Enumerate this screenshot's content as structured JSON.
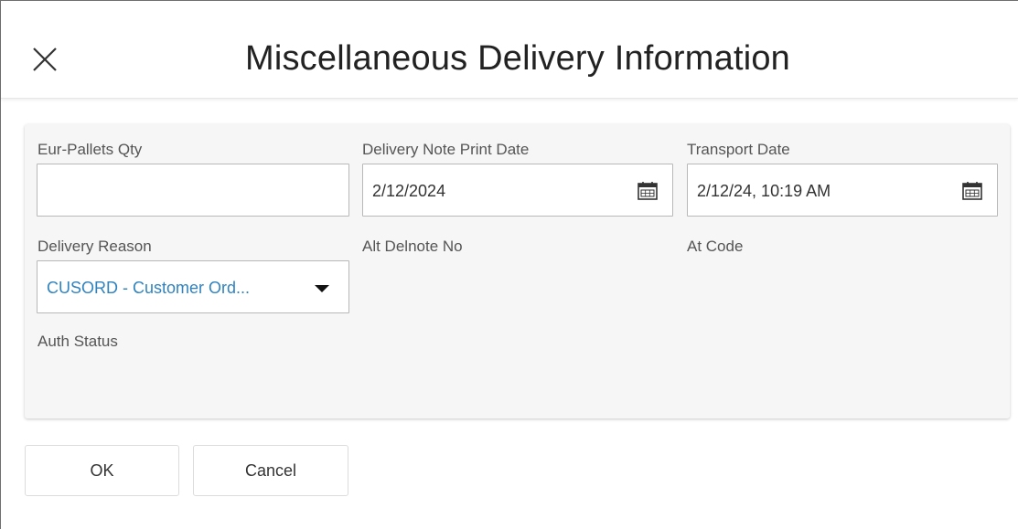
{
  "dialog": {
    "title": "Miscellaneous Delivery Information"
  },
  "fields": {
    "eur_pallets_qty": {
      "label": "Eur-Pallets Qty",
      "value": ""
    },
    "delivery_note_print_date": {
      "label": "Delivery Note Print Date",
      "value": "2/12/2024"
    },
    "transport_date": {
      "label": "Transport Date",
      "value": "2/12/24, 10:19 AM"
    },
    "delivery_reason": {
      "label": "Delivery Reason",
      "value": "CUSORD - Customer Ord..."
    },
    "alt_delnote_no": {
      "label": "Alt Delnote No"
    },
    "at_code": {
      "label": "At Code"
    },
    "auth_status": {
      "label": "Auth Status"
    }
  },
  "buttons": {
    "ok": "OK",
    "cancel": "Cancel"
  },
  "icons": {
    "close": "close-icon",
    "calendar": "calendar-icon",
    "dropdown": "caret-down-icon"
  },
  "colors": {
    "link_value": "#2f83bf",
    "panel_bg": "#f6f6f6"
  }
}
